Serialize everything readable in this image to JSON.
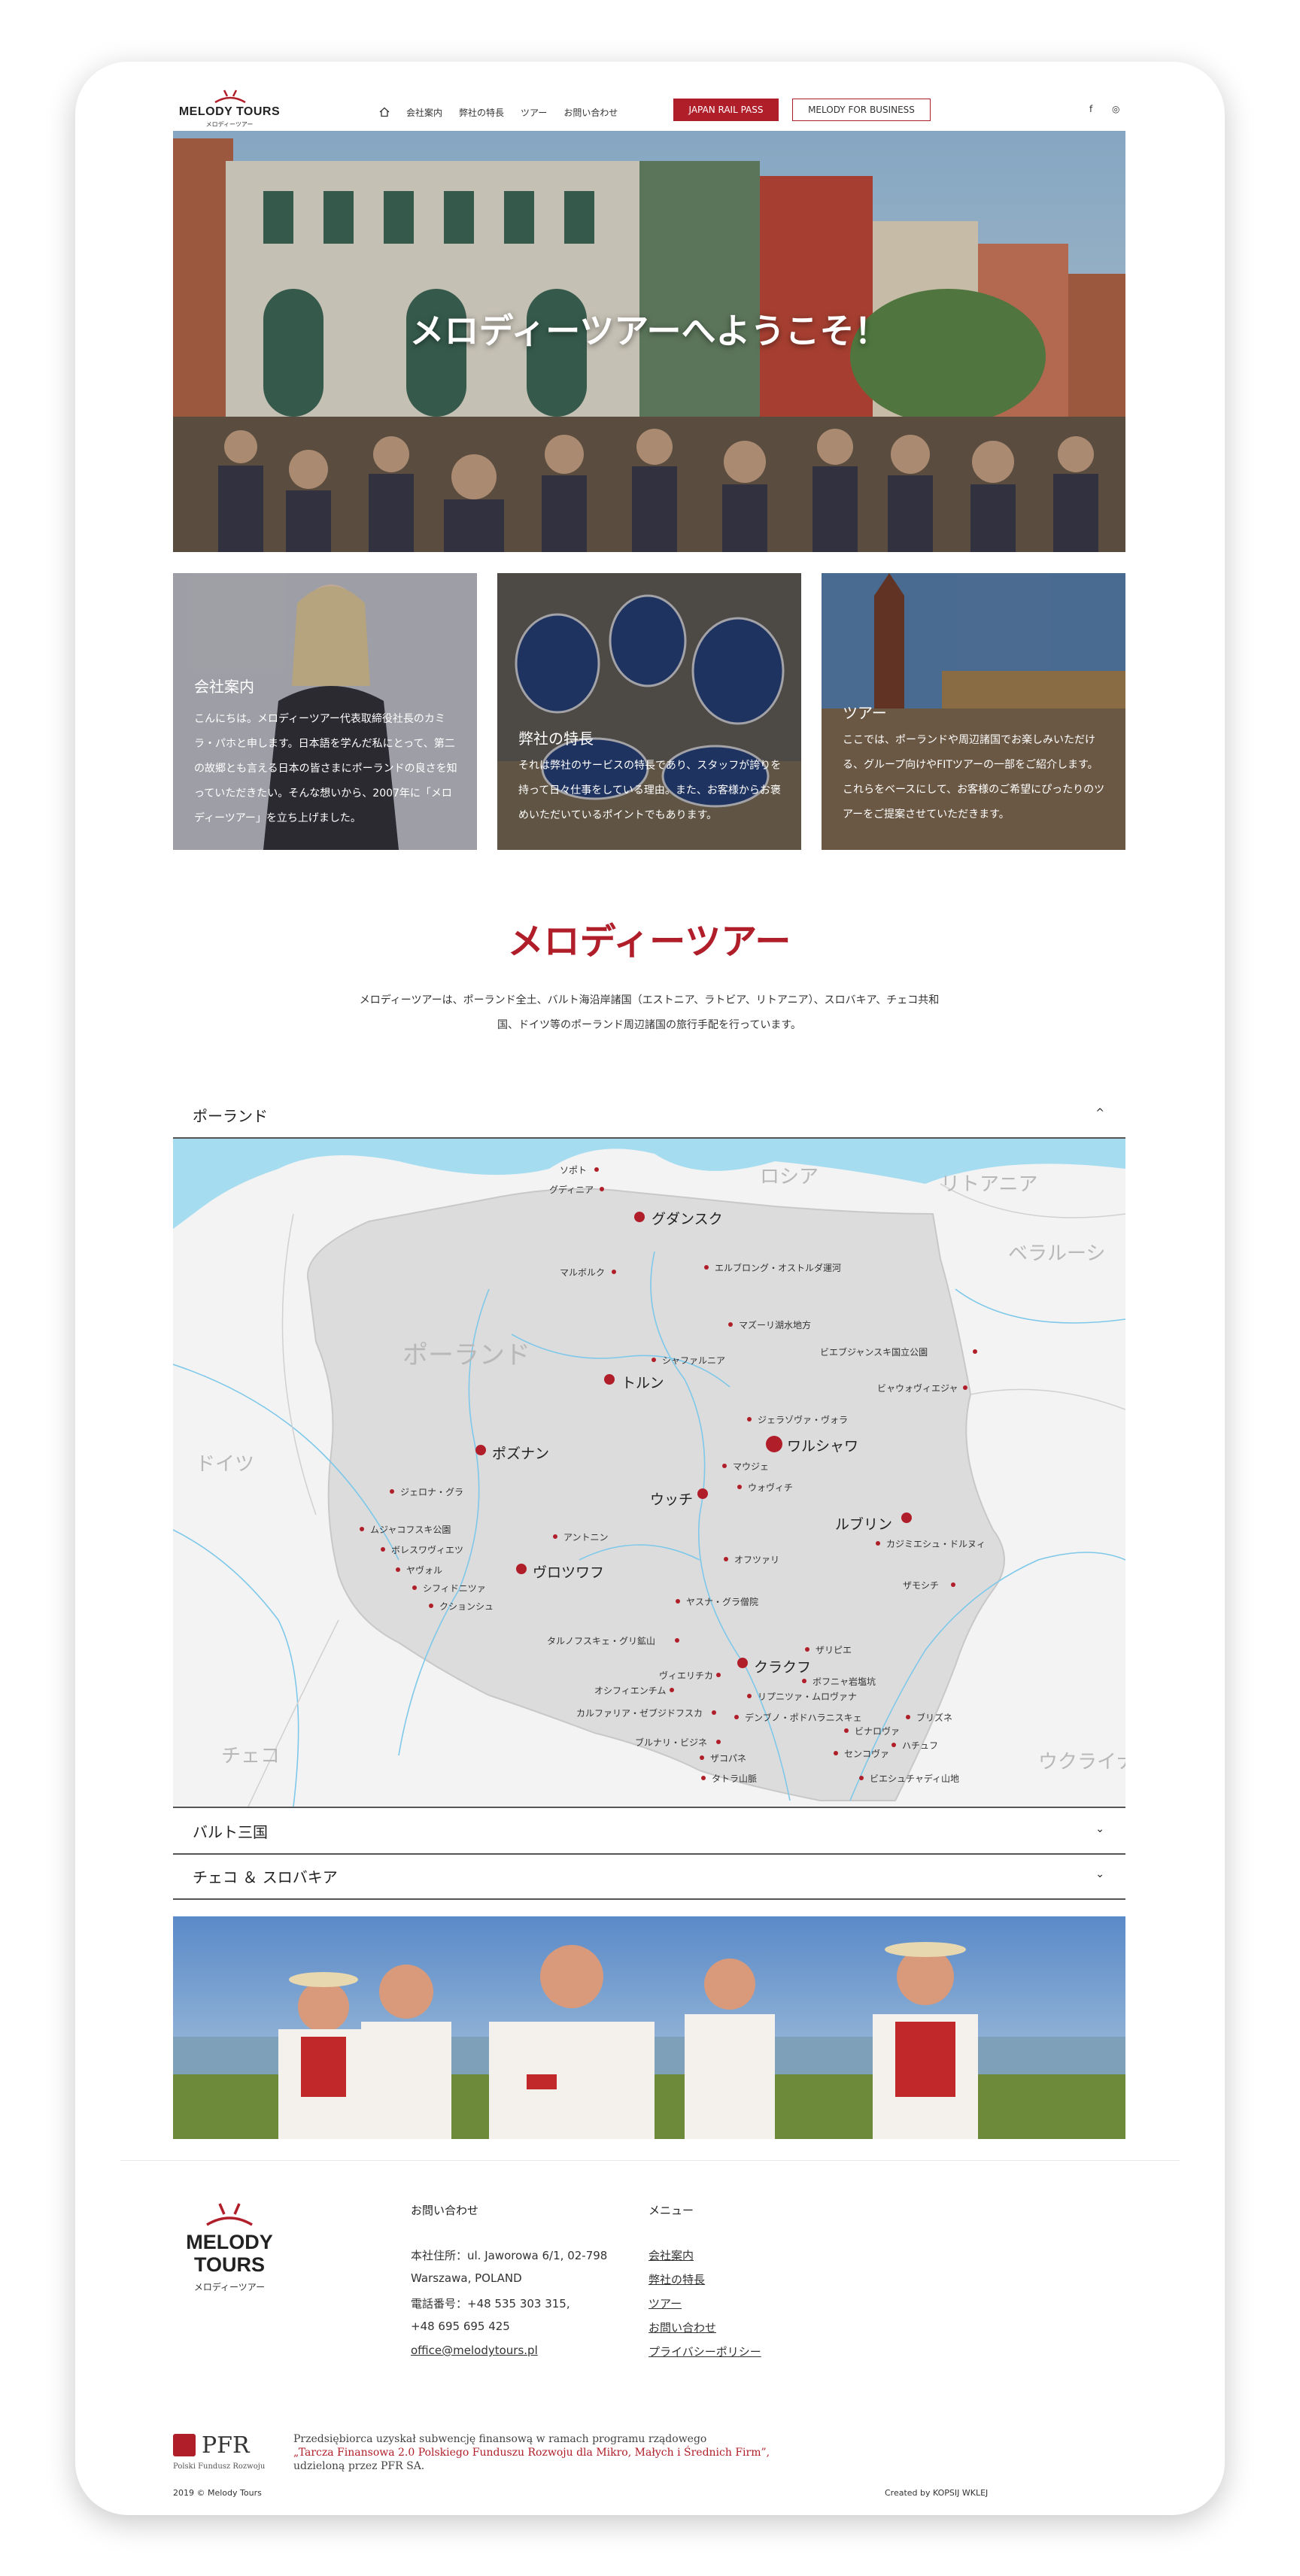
{
  "header": {
    "logo": {
      "name": "MELODY TOURS",
      "sub": "メロディーツアー"
    },
    "nav": [
      "会社案内",
      "弊社の特長",
      "ツアー",
      "お問い合わせ"
    ],
    "btn_jrp": "JAPAN RAIL PASS",
    "btn_business": "MELODY FOR BUSINESS",
    "social": [
      "f",
      "◎"
    ]
  },
  "hero": {
    "title": "メロディーツアーへようこそ！"
  },
  "cards": [
    {
      "title": "会社案内",
      "body": "こんにちは。メロディーツアー代表取締役社長のカミラ・パホと申します。日本語を学んだ私にとって、第二の故郷とも言える日本の皆さまにポーランドの良さを知っていただきたい。そんな想いから、2007年に「メロディーツアー」を立ち上げました。"
    },
    {
      "title": "弊社の特長",
      "body": "それは弊社のサービスの特長であり、スタッフが誇りを持って日々仕事をしている理由。また、お客様からお褒めいただいているポイントでもあります。"
    },
    {
      "title": "ツアー",
      "body": "ここでは、ポーランドや周辺諸国でお楽しみいただける、グループ向けやFITツアーの一部をご紹介します。これらをベースにして、お客様のご希望にぴったりのツアーをご提案させていただきます。"
    }
  ],
  "intro": {
    "title": "メロディーツアー",
    "line1": "メロディーツアーは、ポーランド全土、バルト海沿岸諸国（エストニア、ラトビア、リトアニア）、スロバキア、チェコ共和",
    "line2": "国、ドイツ等のポーランド周辺諸国の旅行手配を行っています。"
  },
  "accordion": [
    {
      "label": "ポーランド",
      "chev": "^"
    },
    {
      "label": "バルト三国",
      "chev": "⌄"
    },
    {
      "label": "チェコ ＆ スロバキア",
      "chev": "⌄"
    }
  ],
  "map": {
    "countries": [
      "ロシア",
      "リトアニア",
      "ベラルーシ",
      "ポーランド",
      "ドイツ",
      "チェコ",
      "ウクライナ"
    ],
    "big_cities": [
      "グダンスク",
      "トルン",
      "ポズナン",
      "ワルシャワ",
      "ウッチ",
      "ルブリン",
      "ヴロツワフ",
      "クラクフ"
    ],
    "cities": [
      "ソポト",
      "グディニア",
      "マルボルク",
      "エルブロング・オストルダ運河",
      "マズーリ湖水地方",
      "ビエブジャンスキ国立公園",
      "シャファルニア",
      "ビャウォヴィエジャ",
      "ジェラゾヴァ・ヴォラ",
      "マウジェ",
      "ウォヴィチ",
      "ジェロナ・グラ",
      "ムジャコフスキ公園",
      "ボレスワヴィエツ",
      "ヤヴォル",
      "シフィドニツァ",
      "クションシュ",
      "アントニン",
      "オフツァリ",
      "カジミエシュ・ドルヌィ",
      "ザモシチ",
      "ヤスナ・グラ僧院",
      "タルノフスキェ・グリ鉱山",
      "ザリピエ",
      "ヴィエリチカ",
      "ボフニャ岩塩坑",
      "オシフィエンチム",
      "リプニツァ・ムロヴァナ",
      "カルファリア・ゼブジドフスカ",
      "デンブノ・ポドハラニスキェ",
      "ビナロヴァ",
      "ブリズネ",
      "ブルナリ・ビジネ",
      "ハチュフ",
      "ザコパネ",
      "センコヴァ",
      "タトラ山脈",
      "ビエシュチャディ山地"
    ]
  },
  "footer": {
    "logo": {
      "line1": "MELODY",
      "line2": "TOURS",
      "sub": "メロディーツアー"
    },
    "contact_heading": "お問い合わせ",
    "address1": "本社住所：ul. Jaworowa 6/1, 02-798",
    "address2": "Warszawa, POLAND",
    "phone1": "電話番号：+48 535 303 315,",
    "phone2": "+48 695 695 425",
    "email": "office@melodytours.pl",
    "menu_heading": "メニュー",
    "menu": [
      "会社案内",
      "弊社の特長",
      "ツアー",
      "お問い合わせ",
      "プライバシーポリシー"
    ],
    "pfr": {
      "logo": "PFR",
      "sub": "Polski Fundusz Rozwoju",
      "line1": "Przedsiębiorca uzyskał subwencję finansową w ramach programu rządowego",
      "line2": "„Tarcza Finansowa 2.0 Polskiego Funduszu Rozwoju dla Mikro, Małych i Średnich Firm”,",
      "line3": "udzieloną przez PFR SA."
    },
    "copyright": "2019 © Melody Tours",
    "created": "Created by KOPSIJ WKLEJ"
  },
  "colors": {
    "accent": "#b01e2a",
    "sea": "#a6dcf0"
  }
}
